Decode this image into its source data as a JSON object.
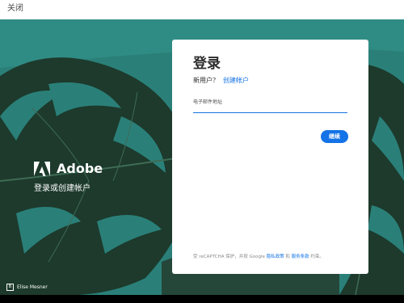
{
  "topbar": {
    "close_label": "关闭"
  },
  "brand": {
    "logo_icon": "adobe-logo-icon",
    "name": "Adobe",
    "tagline": "登录或创建帐户"
  },
  "photo_credit": {
    "icon": "behance-icon",
    "name": "Elise Mesner"
  },
  "login_card": {
    "title": "登录",
    "new_user_prompt": "新用户？",
    "create_account_link": "创建帐户",
    "email_label": "电子邮件地址",
    "email_value": "",
    "continue_button": "继续",
    "recaptcha": {
      "prefix": "受 reCAPTCHA 保护，并按 Google",
      "privacy_link": "隐私政策",
      "and": "和",
      "terms_link": "服务条款",
      "suffix": "约束。"
    }
  },
  "colors": {
    "accent": "#1473e6",
    "background_teal": "#2a7f7a",
    "leaf_dark": "#1e3b2e"
  }
}
